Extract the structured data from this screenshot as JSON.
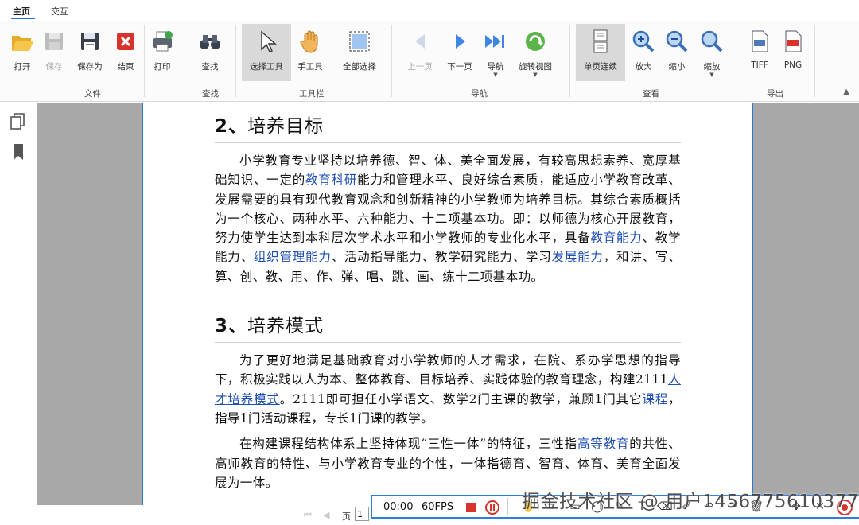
{
  "tabs": [
    {
      "label": "主页"
    },
    {
      "label": "交互"
    }
  ],
  "ribbon": {
    "buttons": {
      "open": "打开",
      "save": "保存",
      "save_as": "保存为",
      "close": "结束",
      "print": "打印",
      "find": "查找",
      "select": "选择工具",
      "hand": "手工具",
      "select_all": "全部选择",
      "prev": "上一页",
      "next": "下一页",
      "nav": "导航",
      "rotate": "旋转视图",
      "single_page": "单页连续",
      "zoom_in": "放大",
      "zoom_out": "缩小",
      "zoom": "缩放",
      "tiff": "TIFF",
      "png": "PNG"
    },
    "groups": {
      "file": "文件",
      "find": "查找",
      "toolbar": "工具栏",
      "nav": "导航",
      "view": "查看",
      "export": "导出"
    }
  },
  "document": {
    "section2": {
      "heading_num": "2、",
      "heading_text": "培养目标",
      "p1_a": "小学教育专业坚持以培养德、智、体、美全面发展，有较高思想素养、宽厚基础知识、一定的",
      "p1_link1": "教育科研",
      "p1_b": "能力和管理水平、良好综合素质，能适应小学教育改革、发展需要的具有现代教育观念和创新精神的小学教师为培养目标。其综合素质概括为一个核心、两种水平、六种能力、十二项基本功。即：以师德为核心开展教育，努力使学生达到本科层次学术水平和小学教师的专业化水平，具备",
      "p1_link2": "教育能力",
      "p1_c": "、教学能力、",
      "p1_link3": "组织管理能力",
      "p1_d": "、活动指导能力、教学研究能力、学习",
      "p1_link4": "发展能力",
      "p1_e": "，和讲、写、算、创、教、用、作、弹、唱、跳、画、练十二项基本功。"
    },
    "section3": {
      "heading_num": "3、",
      "heading_text": "培养模式",
      "p1_a": "为了更好地满足基础教育对小学教师的人才需求，在院、系办学思想的指导下，积极实践以人为本、整体教育、目标培养、实践体验的教育理念，构建2111",
      "p1_link1": "人才培养模式",
      "p1_b": "。2111即可担任小学语文、数学2门主课的教学，兼顾1门其它",
      "p1_link2": "课程",
      "p1_c": "，指导1门活动课程，专长1门课的教学。",
      "p2_a": "在构建课程结构体系上坚持体现“三性一体”的特征，三性指",
      "p2_link1": "高等教育",
      "p2_b": "的共性、高师教育的特性、与小学教育专业的个性，一体指德育、智育、体育、美育全面发展为一体。"
    }
  },
  "pager": {
    "label": "页",
    "current": "1"
  },
  "recorder": {
    "time": "00:00",
    "fps": "60FPS"
  },
  "watermark": "掘金技术社区 @ 用户1456775610377",
  "colors": {
    "accent": "#2b6cd6",
    "link": "#1f4fb4",
    "record_red": "#d9342b"
  }
}
